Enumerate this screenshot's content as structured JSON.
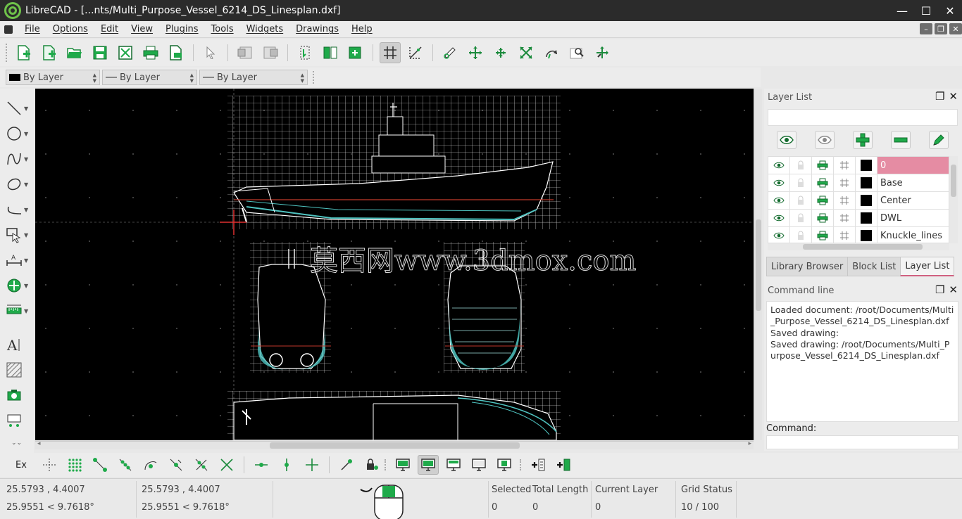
{
  "window": {
    "title": "LibreCAD - [...nts/Multi_Purpose_Vessel_6214_DS_Linesplan.dxf]",
    "minimize": "—",
    "maximize": "☐",
    "close": "✕"
  },
  "menu": {
    "items": [
      "File",
      "Options",
      "Edit",
      "View",
      "Plugins",
      "Tools",
      "Widgets",
      "Drawings",
      "Help"
    ]
  },
  "mdi_controls": [
    "–",
    "❐",
    "✕"
  ],
  "pen_toolbar": {
    "color": "By Layer",
    "line_width": "By Layer",
    "line_type": "By Layer"
  },
  "canvas": {
    "background": "#000000",
    "watermark": "莫西网www.3dmox.com"
  },
  "layer_list": {
    "title": "Layer List",
    "layers": [
      {
        "name": "0",
        "selected": true
      },
      {
        "name": "Base",
        "selected": false
      },
      {
        "name": "Center",
        "selected": false
      },
      {
        "name": "DWL",
        "selected": false
      },
      {
        "name": "Knuckle_lines",
        "selected": false
      }
    ]
  },
  "dock_tabs": [
    "Library Browser",
    "Block List",
    "Layer List"
  ],
  "command_line": {
    "title": "Command line",
    "output": [
      "Loaded document: /root/Documents/Multi_Purpose_Vessel_6214_DS_Linesplan.dxf",
      "Saved drawing:",
      "Saved drawing: /root/Documents/Multi_Purpose_Vessel_6214_DS_Linesplan.dxf"
    ],
    "prompt_label": "Command:"
  },
  "snap_toolbar": {
    "ex_label": "Ex"
  },
  "status": {
    "abs_coord": "25.5793 , 4.4007",
    "abs_polar": "25.9551 < 9.7618°",
    "rel_coord": "25.5793 , 4.4007",
    "rel_polar": "25.9551 < 9.7618°",
    "selected_label": "Selected",
    "selected_value": "0",
    "total_length_label": "Total Length",
    "total_length_value": "0",
    "current_layer_label": "Current Layer",
    "current_layer_value": "0",
    "grid_status_label": "Grid Status",
    "grid_status_value": "10 / 100"
  },
  "colors": {
    "accent_green": "#1faa4a",
    "selected_layer": "#e58ca3",
    "drawing_lines": "#ffffff",
    "hull_cyan": "#4fc3c0"
  }
}
